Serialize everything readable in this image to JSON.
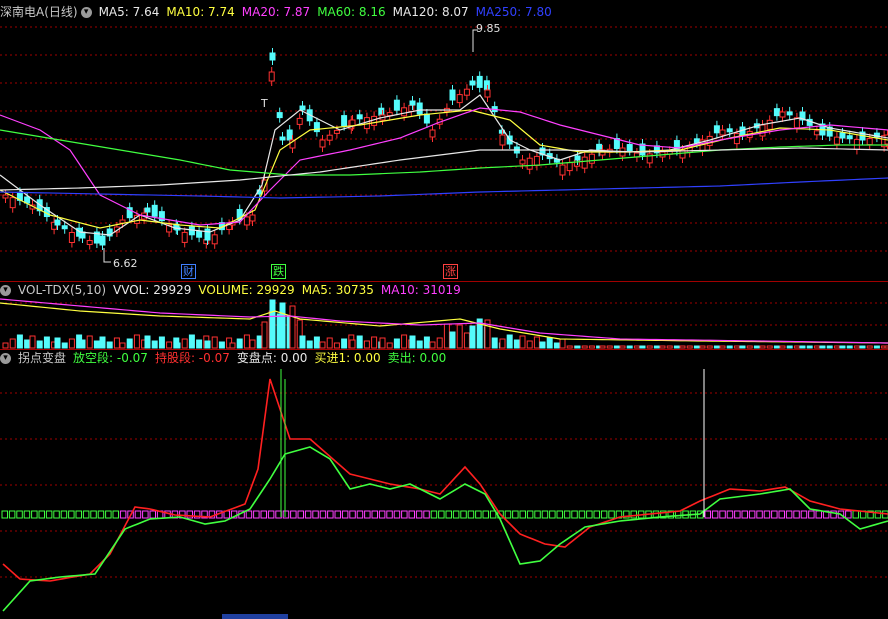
{
  "main_panel": {
    "legend": [
      {
        "text": "深南电A(日线)",
        "color": "#c8c8c8"
      },
      {
        "text": "MA5: 7.64",
        "color": "#e8e8e8"
      },
      {
        "text": "MA10: 7.74",
        "color": "#ffff40"
      },
      {
        "text": "MA20: 7.87",
        "color": "#ff40ff"
      },
      {
        "text": "MA60: 8.16",
        "color": "#40ff40"
      },
      {
        "text": "MA120: 8.07",
        "color": "#e8e8e8"
      },
      {
        "text": "MA250: 7.80",
        "color": "#3040ff"
      }
    ],
    "high_label": "9.85",
    "low_label": "6.62",
    "markers": [
      {
        "text": "财",
        "color": "#4080ff"
      },
      {
        "text": "跌",
        "color": "#40ff40"
      },
      {
        "text": "涨",
        "color": "#ff4040"
      }
    ],
    "t_mark": "T"
  },
  "volume_panel": {
    "legend": [
      {
        "text": "VOL-TDX(5,10)",
        "color": "#c8c8c8"
      },
      {
        "text": "VVOL: 29929",
        "color": "#e8e8e8"
      },
      {
        "text": "VOLUME: 29929",
        "color": "#ffff40"
      },
      {
        "text": "MA5: 30735",
        "color": "#ffff40"
      },
      {
        "text": "MA10: 31019",
        "color": "#ff40ff"
      }
    ]
  },
  "indicator_panel": {
    "legend": [
      {
        "text": "拐点变盘",
        "color": "#c8c8c8"
      },
      {
        "text": "放空段: -0.07",
        "color": "#40ff40"
      },
      {
        "text": "持股段: -0.07",
        "color": "#ff3030"
      },
      {
        "text": "变盘点: 0.00",
        "color": "#e8e8e8"
      },
      {
        "text": "买进1: 0.00",
        "color": "#ffff40"
      },
      {
        "text": "卖出: 0.00",
        "color": "#40ff40"
      }
    ]
  },
  "colors": {
    "up": "#ff3232",
    "down": "#54fcfc",
    "grid": "#a00000",
    "background": "#000000"
  }
}
